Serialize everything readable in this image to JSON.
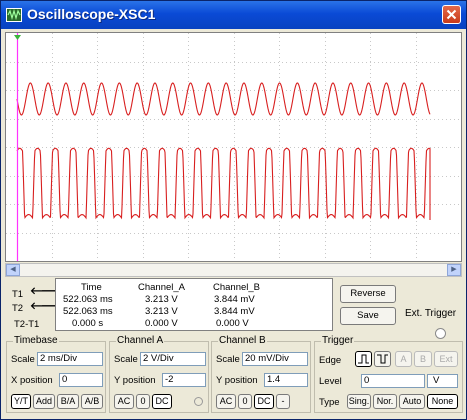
{
  "window": {
    "title": "Oscilloscope-XSC1"
  },
  "cursors": {
    "headers": {
      "time": "Time",
      "channel_a": "Channel_A",
      "channel_b": "Channel_B"
    },
    "rows": [
      {
        "label": "T1",
        "time": "522.063 ms",
        "a": "3.213 V",
        "b": "3.844 mV"
      },
      {
        "label": "T2",
        "time": "522.063 ms",
        "a": "3.213 V",
        "b": "3.844 mV"
      },
      {
        "label": "T2-T1",
        "time": "0.000 s",
        "a": "0.000 V",
        "b": "0.000 V"
      }
    ]
  },
  "actions": {
    "reverse": "Reverse",
    "save": "Save",
    "ext_trigger": "Ext. Trigger"
  },
  "timebase": {
    "group": "Timebase",
    "scale_label": "Scale",
    "scale": "2 ms/Div",
    "xpos_label": "X position",
    "xpos": "0",
    "modes": [
      "Y/T",
      "Add",
      "B/A",
      "A/B"
    ],
    "selected_mode": "Y/T"
  },
  "channel_a": {
    "group": "Channel A",
    "scale_label": "Scale",
    "scale": "2  V/Div",
    "ypos_label": "Y position",
    "ypos": "-2",
    "coupling": [
      "AC",
      "0",
      "DC"
    ]
  },
  "channel_b": {
    "group": "Channel B",
    "scale_label": "Scale",
    "scale": "20 mV/Div",
    "ypos_label": "Y position",
    "ypos": "1.4",
    "coupling": [
      "AC",
      "0",
      "DC",
      "-"
    ]
  },
  "trigger": {
    "group": "Trigger",
    "edge_label": "Edge",
    "edge_buttons": [
      "A",
      "B",
      "Ext"
    ],
    "level_label": "Level",
    "level": "0",
    "level_unit": "V",
    "type_label": "Type",
    "types": [
      "Sing.",
      "Nor.",
      "Auto",
      "None"
    ],
    "selected_type": "None"
  },
  "colors": {
    "trace": "#d81f1f",
    "cursor": "#ff33ff",
    "title_bar": "#0a4ad6",
    "close": "#d04a2a"
  }
}
